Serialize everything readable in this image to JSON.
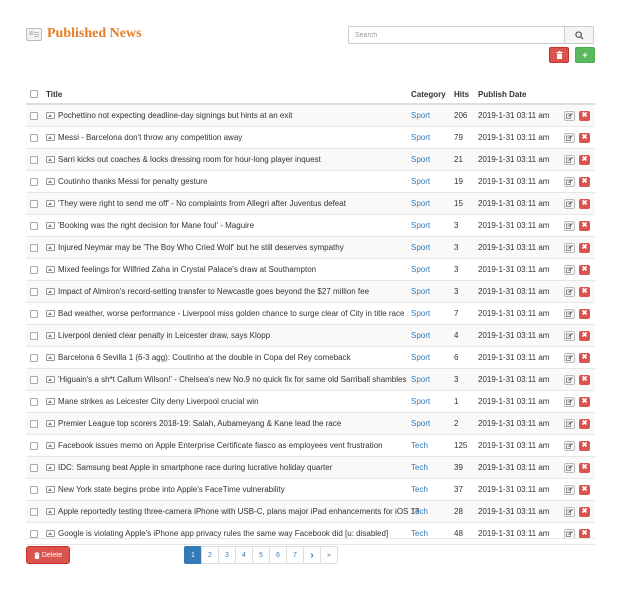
{
  "header": {
    "title": "Published News"
  },
  "search": {
    "placeholder": "Search"
  },
  "toolbar": {
    "delete_icon": "trash-icon",
    "add_icon": "plus-icon",
    "add_label": "+"
  },
  "table": {
    "columns": {
      "title": "Title",
      "category": "Category",
      "hits": "Hits",
      "date": "Publish Date"
    },
    "rows": [
      {
        "title": "Pochettino not expecting deadline-day signings but hints at an exit",
        "category": "Sport",
        "hits": "206",
        "date": "2019-1-31 03:11 am"
      },
      {
        "title": "Messi - Barcelona don't throw any competition away",
        "category": "Sport",
        "hits": "79",
        "date": "2019-1-31 03:11 am"
      },
      {
        "title": "Sarri kicks out coaches & locks dressing room for hour-long player inquest",
        "category": "Sport",
        "hits": "21",
        "date": "2019-1-31 03:11 am"
      },
      {
        "title": "Coutinho thanks Messi for penalty gesture",
        "category": "Sport",
        "hits": "19",
        "date": "2019-1-31 03:11 am"
      },
      {
        "title": "'They were right to send me off' - No complaints from Allegri after Juventus defeat",
        "category": "Sport",
        "hits": "15",
        "date": "2019-1-31 03:11 am"
      },
      {
        "title": "'Booking was the right decision for Mane foul' - Maguire",
        "category": "Sport",
        "hits": "3",
        "date": "2019-1-31 03:11 am"
      },
      {
        "title": "Injured Neymar may be 'The Boy Who Cried Wolf' but he still deserves sympathy",
        "category": "Sport",
        "hits": "3",
        "date": "2019-1-31 03:11 am"
      },
      {
        "title": "Mixed feelings for Wilfried Zaha in Crystal Palace's draw at Southampton",
        "category": "Sport",
        "hits": "3",
        "date": "2019-1-31 03:11 am"
      },
      {
        "title": "Impact of Almiron's record-setting transfer to Newcastle goes beyond the $27 million fee",
        "category": "Sport",
        "hits": "3",
        "date": "2019-1-31 03:11 am"
      },
      {
        "title": "Bad weather, worse performance - Liverpool miss golden chance to surge clear of City in title race",
        "category": "Sport",
        "hits": "7",
        "date": "2019-1-31 03:11 am"
      },
      {
        "title": "Liverpool denied clear penalty in Leicester draw, says Klopp",
        "category": "Sport",
        "hits": "4",
        "date": "2019-1-31 03:11 am"
      },
      {
        "title": "Barcelona 6 Sevilla 1 (6-3 agg): Coutinho at the double in Copa del Rey comeback",
        "category": "Sport",
        "hits": "6",
        "date": "2019-1-31 03:11 am"
      },
      {
        "title": "'Higuain's a sh*t Callum Wilson!' - Chelsea's new No.9 no quick fix for same old Sarriball shambles",
        "category": "Sport",
        "hits": "3",
        "date": "2019-1-31 03:11 am"
      },
      {
        "title": "Mane strikes as Leicester City deny Liverpool crucial win",
        "category": "Sport",
        "hits": "1",
        "date": "2019-1-31 03:11 am"
      },
      {
        "title": "Premier League top scorers 2018-19: Salah, Aubameyang & Kane lead the race",
        "category": "Sport",
        "hits": "2",
        "date": "2019-1-31 03:11 am"
      },
      {
        "title": "Facebook issues memo on Apple Enterprise Certificate fiasco as employees vent frustration",
        "category": "Tech",
        "hits": "125",
        "date": "2019-1-31 03:11 am"
      },
      {
        "title": "IDC: Samsung beat Apple in smartphone race during lucrative holiday quarter",
        "category": "Tech",
        "hits": "39",
        "date": "2019-1-31 03:11 am"
      },
      {
        "title": "New York state begins probe into Apple's FaceTime vulnerability",
        "category": "Tech",
        "hits": "37",
        "date": "2019-1-31 03:11 am"
      },
      {
        "title": "Apple reportedly testing three-camera iPhone with USB-C, plans major iPad enhancements for iOS 13",
        "category": "Tech",
        "hits": "28",
        "date": "2019-1-31 03:11 am"
      },
      {
        "title": "Google is violating Apple's iPhone app privacy rules the same way Facebook did [u: disabled]",
        "category": "Tech",
        "hits": "48",
        "date": "2019-1-31 03:11 am"
      }
    ]
  },
  "footer": {
    "delete_label": "Delete",
    "pages": [
      "1",
      "2",
      "3",
      "4",
      "5",
      "6",
      "7"
    ],
    "active_page": "1",
    "next_label": "›",
    "last_label": "»"
  }
}
